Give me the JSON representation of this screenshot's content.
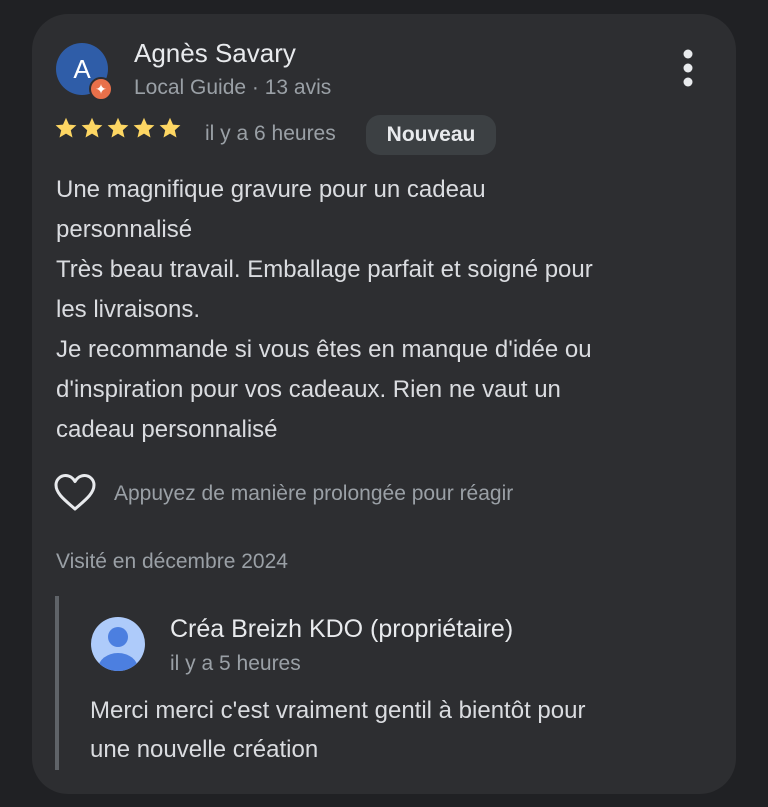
{
  "review": {
    "avatar_initial": "A",
    "author_name": "Agnès Savary",
    "author_meta": "Local Guide · 13 avis",
    "rating": 5,
    "rating_max": 5,
    "time_ago": "il y a 6 heures",
    "badge": "Nouveau",
    "text_lines": [
      "Une magnifique gravure pour un cadeau",
      "personnalisé",
      "Très beau travail. Emballage parfait et soigné pour",
      "les livraisons.",
      "Je recommande si vous êtes en manque d'idée ou",
      "d'inspiration pour vos cadeaux. Rien ne vaut un",
      "cadeau personnalisé"
    ],
    "react_hint": "Appuyez de manière prolongée pour réagir",
    "visited": "Visité en décembre 2024"
  },
  "owner_reply": {
    "name": "Créa Breizh KDO (propriétaire)",
    "time_ago": "il y a 5 heures",
    "text_lines": [
      "Merci merci c'est vraiment gentil à bientôt pour",
      "une nouvelle création"
    ]
  },
  "colors": {
    "background": "#202124",
    "card": "#2d2e31",
    "star": "#fdd663",
    "avatar": "#2f5da8",
    "local_guide_badge": "#e8704a",
    "owner_avatar": "#aecbfa"
  },
  "icons": {
    "menu": "more-vert-icon",
    "star": "star-icon",
    "heart": "heart-outline-icon",
    "owner_avatar": "person-icon",
    "local_guide": "local-guide-badge-icon"
  }
}
